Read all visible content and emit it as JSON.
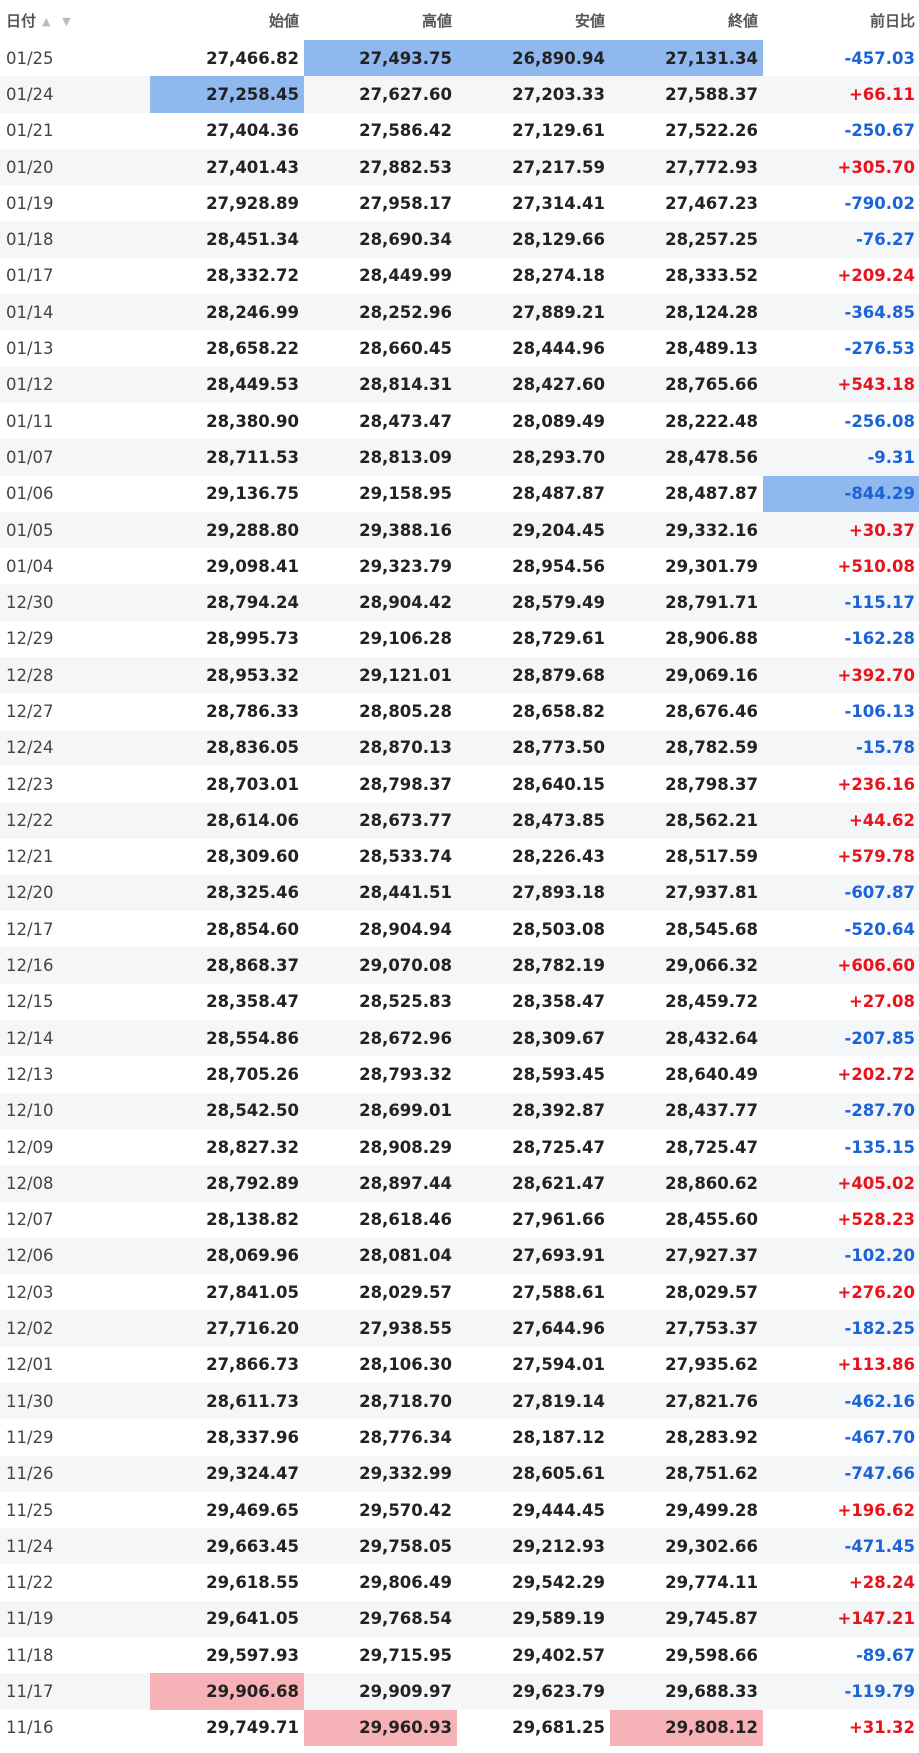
{
  "colors": {
    "positive": "#e8131b",
    "negative": "#1b63d8",
    "highlight_low": "#8fb8ef",
    "highlight_high": "#f6b2b6"
  },
  "header": {
    "date": "日付",
    "open": "始値",
    "high": "高値",
    "low": "安値",
    "close": "終値",
    "change": "前日比",
    "sort_icons": "▲ ▼"
  },
  "rows": [
    {
      "date": "01/25",
      "open": "27,466.82",
      "high": "27,493.75",
      "low": "26,890.94",
      "close": "27,131.34",
      "change": "-457.03",
      "hl": {
        "high": "low",
        "low": "low",
        "close": "low"
      }
    },
    {
      "date": "01/24",
      "open": "27,258.45",
      "high": "27,627.60",
      "low": "27,203.33",
      "close": "27,588.37",
      "change": "+66.11",
      "hl": {
        "open": "low"
      }
    },
    {
      "date": "01/21",
      "open": "27,404.36",
      "high": "27,586.42",
      "low": "27,129.61",
      "close": "27,522.26",
      "change": "-250.67"
    },
    {
      "date": "01/20",
      "open": "27,401.43",
      "high": "27,882.53",
      "low": "27,217.59",
      "close": "27,772.93",
      "change": "+305.70"
    },
    {
      "date": "01/19",
      "open": "27,928.89",
      "high": "27,958.17",
      "low": "27,314.41",
      "close": "27,467.23",
      "change": "-790.02"
    },
    {
      "date": "01/18",
      "open": "28,451.34",
      "high": "28,690.34",
      "low": "28,129.66",
      "close": "28,257.25",
      "change": "-76.27"
    },
    {
      "date": "01/17",
      "open": "28,332.72",
      "high": "28,449.99",
      "low": "28,274.18",
      "close": "28,333.52",
      "change": "+209.24"
    },
    {
      "date": "01/14",
      "open": "28,246.99",
      "high": "28,252.96",
      "low": "27,889.21",
      "close": "28,124.28",
      "change": "-364.85"
    },
    {
      "date": "01/13",
      "open": "28,658.22",
      "high": "28,660.45",
      "low": "28,444.96",
      "close": "28,489.13",
      "change": "-276.53"
    },
    {
      "date": "01/12",
      "open": "28,449.53",
      "high": "28,814.31",
      "low": "28,427.60",
      "close": "28,765.66",
      "change": "+543.18"
    },
    {
      "date": "01/11",
      "open": "28,380.90",
      "high": "28,473.47",
      "low": "28,089.49",
      "close": "28,222.48",
      "change": "-256.08"
    },
    {
      "date": "01/07",
      "open": "28,711.53",
      "high": "28,813.09",
      "low": "28,293.70",
      "close": "28,478.56",
      "change": "-9.31"
    },
    {
      "date": "01/06",
      "open": "29,136.75",
      "high": "29,158.95",
      "low": "28,487.87",
      "close": "28,487.87",
      "change": "-844.29",
      "hl": {
        "change": "low"
      }
    },
    {
      "date": "01/05",
      "open": "29,288.80",
      "high": "29,388.16",
      "low": "29,204.45",
      "close": "29,332.16",
      "change": "+30.37"
    },
    {
      "date": "01/04",
      "open": "29,098.41",
      "high": "29,323.79",
      "low": "28,954.56",
      "close": "29,301.79",
      "change": "+510.08"
    },
    {
      "date": "12/30",
      "open": "28,794.24",
      "high": "28,904.42",
      "low": "28,579.49",
      "close": "28,791.71",
      "change": "-115.17"
    },
    {
      "date": "12/29",
      "open": "28,995.73",
      "high": "29,106.28",
      "low": "28,729.61",
      "close": "28,906.88",
      "change": "-162.28"
    },
    {
      "date": "12/28",
      "open": "28,953.32",
      "high": "29,121.01",
      "low": "28,879.68",
      "close": "29,069.16",
      "change": "+392.70"
    },
    {
      "date": "12/27",
      "open": "28,786.33",
      "high": "28,805.28",
      "low": "28,658.82",
      "close": "28,676.46",
      "change": "-106.13"
    },
    {
      "date": "12/24",
      "open": "28,836.05",
      "high": "28,870.13",
      "low": "28,773.50",
      "close": "28,782.59",
      "change": "-15.78"
    },
    {
      "date": "12/23",
      "open": "28,703.01",
      "high": "28,798.37",
      "low": "28,640.15",
      "close": "28,798.37",
      "change": "+236.16"
    },
    {
      "date": "12/22",
      "open": "28,614.06",
      "high": "28,673.77",
      "low": "28,473.85",
      "close": "28,562.21",
      "change": "+44.62"
    },
    {
      "date": "12/21",
      "open": "28,309.60",
      "high": "28,533.74",
      "low": "28,226.43",
      "close": "28,517.59",
      "change": "+579.78"
    },
    {
      "date": "12/20",
      "open": "28,325.46",
      "high": "28,441.51",
      "low": "27,893.18",
      "close": "27,937.81",
      "change": "-607.87"
    },
    {
      "date": "12/17",
      "open": "28,854.60",
      "high": "28,904.94",
      "low": "28,503.08",
      "close": "28,545.68",
      "change": "-520.64"
    },
    {
      "date": "12/16",
      "open": "28,868.37",
      "high": "29,070.08",
      "low": "28,782.19",
      "close": "29,066.32",
      "change": "+606.60"
    },
    {
      "date": "12/15",
      "open": "28,358.47",
      "high": "28,525.83",
      "low": "28,358.47",
      "close": "28,459.72",
      "change": "+27.08"
    },
    {
      "date": "12/14",
      "open": "28,554.86",
      "high": "28,672.96",
      "low": "28,309.67",
      "close": "28,432.64",
      "change": "-207.85"
    },
    {
      "date": "12/13",
      "open": "28,705.26",
      "high": "28,793.32",
      "low": "28,593.45",
      "close": "28,640.49",
      "change": "+202.72"
    },
    {
      "date": "12/10",
      "open": "28,542.50",
      "high": "28,699.01",
      "low": "28,392.87",
      "close": "28,437.77",
      "change": "-287.70"
    },
    {
      "date": "12/09",
      "open": "28,827.32",
      "high": "28,908.29",
      "low": "28,725.47",
      "close": "28,725.47",
      "change": "-135.15"
    },
    {
      "date": "12/08",
      "open": "28,792.89",
      "high": "28,897.44",
      "low": "28,621.47",
      "close": "28,860.62",
      "change": "+405.02"
    },
    {
      "date": "12/07",
      "open": "28,138.82",
      "high": "28,618.46",
      "low": "27,961.66",
      "close": "28,455.60",
      "change": "+528.23"
    },
    {
      "date": "12/06",
      "open": "28,069.96",
      "high": "28,081.04",
      "low": "27,693.91",
      "close": "27,927.37",
      "change": "-102.20"
    },
    {
      "date": "12/03",
      "open": "27,841.05",
      "high": "28,029.57",
      "low": "27,588.61",
      "close": "28,029.57",
      "change": "+276.20"
    },
    {
      "date": "12/02",
      "open": "27,716.20",
      "high": "27,938.55",
      "low": "27,644.96",
      "close": "27,753.37",
      "change": "-182.25"
    },
    {
      "date": "12/01",
      "open": "27,866.73",
      "high": "28,106.30",
      "low": "27,594.01",
      "close": "27,935.62",
      "change": "+113.86"
    },
    {
      "date": "11/30",
      "open": "28,611.73",
      "high": "28,718.70",
      "low": "27,819.14",
      "close": "27,821.76",
      "change": "-462.16"
    },
    {
      "date": "11/29",
      "open": "28,337.96",
      "high": "28,776.34",
      "low": "28,187.12",
      "close": "28,283.92",
      "change": "-467.70"
    },
    {
      "date": "11/26",
      "open": "29,324.47",
      "high": "29,332.99",
      "low": "28,605.61",
      "close": "28,751.62",
      "change": "-747.66"
    },
    {
      "date": "11/25",
      "open": "29,469.65",
      "high": "29,570.42",
      "low": "29,444.45",
      "close": "29,499.28",
      "change": "+196.62"
    },
    {
      "date": "11/24",
      "open": "29,663.45",
      "high": "29,758.05",
      "low": "29,212.93",
      "close": "29,302.66",
      "change": "-471.45"
    },
    {
      "date": "11/22",
      "open": "29,618.55",
      "high": "29,806.49",
      "low": "29,542.29",
      "close": "29,774.11",
      "change": "+28.24"
    },
    {
      "date": "11/19",
      "open": "29,641.05",
      "high": "29,768.54",
      "low": "29,589.19",
      "close": "29,745.87",
      "change": "+147.21"
    },
    {
      "date": "11/18",
      "open": "29,597.93",
      "high": "29,715.95",
      "low": "29,402.57",
      "close": "29,598.66",
      "change": "-89.67"
    },
    {
      "date": "11/17",
      "open": "29,906.68",
      "high": "29,909.97",
      "low": "29,623.79",
      "close": "29,688.33",
      "change": "-119.79",
      "hl": {
        "open": "high"
      }
    },
    {
      "date": "11/16",
      "open": "29,749.71",
      "high": "29,960.93",
      "low": "29,681.25",
      "close": "29,808.12",
      "change": "+31.32",
      "hl": {
        "high": "high",
        "close": "high"
      }
    }
  ]
}
